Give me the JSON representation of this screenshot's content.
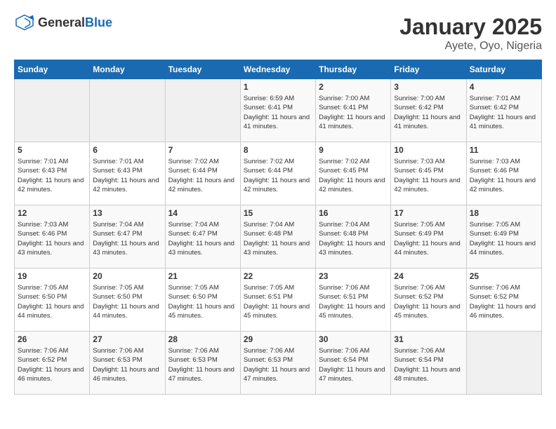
{
  "header": {
    "logo_general": "General",
    "logo_blue": "Blue",
    "title": "January 2025",
    "location": "Ayete, Oyo, Nigeria"
  },
  "weekdays": [
    "Sunday",
    "Monday",
    "Tuesday",
    "Wednesday",
    "Thursday",
    "Friday",
    "Saturday"
  ],
  "weeks": [
    [
      {
        "day": "",
        "empty": true
      },
      {
        "day": "",
        "empty": true
      },
      {
        "day": "",
        "empty": true
      },
      {
        "day": "1",
        "sunrise": "Sunrise: 6:59 AM",
        "sunset": "Sunset: 6:41 PM",
        "daylight": "Daylight: 11 hours and 41 minutes."
      },
      {
        "day": "2",
        "sunrise": "Sunrise: 7:00 AM",
        "sunset": "Sunset: 6:41 PM",
        "daylight": "Daylight: 11 hours and 41 minutes."
      },
      {
        "day": "3",
        "sunrise": "Sunrise: 7:00 AM",
        "sunset": "Sunset: 6:42 PM",
        "daylight": "Daylight: 11 hours and 41 minutes."
      },
      {
        "day": "4",
        "sunrise": "Sunrise: 7:01 AM",
        "sunset": "Sunset: 6:42 PM",
        "daylight": "Daylight: 11 hours and 41 minutes."
      }
    ],
    [
      {
        "day": "5",
        "sunrise": "Sunrise: 7:01 AM",
        "sunset": "Sunset: 6:43 PM",
        "daylight": "Daylight: 11 hours and 42 minutes."
      },
      {
        "day": "6",
        "sunrise": "Sunrise: 7:01 AM",
        "sunset": "Sunset: 6:43 PM",
        "daylight": "Daylight: 11 hours and 42 minutes."
      },
      {
        "day": "7",
        "sunrise": "Sunrise: 7:02 AM",
        "sunset": "Sunset: 6:44 PM",
        "daylight": "Daylight: 11 hours and 42 minutes."
      },
      {
        "day": "8",
        "sunrise": "Sunrise: 7:02 AM",
        "sunset": "Sunset: 6:44 PM",
        "daylight": "Daylight: 11 hours and 42 minutes."
      },
      {
        "day": "9",
        "sunrise": "Sunrise: 7:02 AM",
        "sunset": "Sunset: 6:45 PM",
        "daylight": "Daylight: 11 hours and 42 minutes."
      },
      {
        "day": "10",
        "sunrise": "Sunrise: 7:03 AM",
        "sunset": "Sunset: 6:45 PM",
        "daylight": "Daylight: 11 hours and 42 minutes."
      },
      {
        "day": "11",
        "sunrise": "Sunrise: 7:03 AM",
        "sunset": "Sunset: 6:46 PM",
        "daylight": "Daylight: 11 hours and 42 minutes."
      }
    ],
    [
      {
        "day": "12",
        "sunrise": "Sunrise: 7:03 AM",
        "sunset": "Sunset: 6:46 PM",
        "daylight": "Daylight: 11 hours and 43 minutes."
      },
      {
        "day": "13",
        "sunrise": "Sunrise: 7:04 AM",
        "sunset": "Sunset: 6:47 PM",
        "daylight": "Daylight: 11 hours and 43 minutes."
      },
      {
        "day": "14",
        "sunrise": "Sunrise: 7:04 AM",
        "sunset": "Sunset: 6:47 PM",
        "daylight": "Daylight: 11 hours and 43 minutes."
      },
      {
        "day": "15",
        "sunrise": "Sunrise: 7:04 AM",
        "sunset": "Sunset: 6:48 PM",
        "daylight": "Daylight: 11 hours and 43 minutes."
      },
      {
        "day": "16",
        "sunrise": "Sunrise: 7:04 AM",
        "sunset": "Sunset: 6:48 PM",
        "daylight": "Daylight: 11 hours and 43 minutes."
      },
      {
        "day": "17",
        "sunrise": "Sunrise: 7:05 AM",
        "sunset": "Sunset: 6:49 PM",
        "daylight": "Daylight: 11 hours and 44 minutes."
      },
      {
        "day": "18",
        "sunrise": "Sunrise: 7:05 AM",
        "sunset": "Sunset: 6:49 PM",
        "daylight": "Daylight: 11 hours and 44 minutes."
      }
    ],
    [
      {
        "day": "19",
        "sunrise": "Sunrise: 7:05 AM",
        "sunset": "Sunset: 6:50 PM",
        "daylight": "Daylight: 11 hours and 44 minutes."
      },
      {
        "day": "20",
        "sunrise": "Sunrise: 7:05 AM",
        "sunset": "Sunset: 6:50 PM",
        "daylight": "Daylight: 11 hours and 44 minutes."
      },
      {
        "day": "21",
        "sunrise": "Sunrise: 7:05 AM",
        "sunset": "Sunset: 6:50 PM",
        "daylight": "Daylight: 11 hours and 45 minutes."
      },
      {
        "day": "22",
        "sunrise": "Sunrise: 7:05 AM",
        "sunset": "Sunset: 6:51 PM",
        "daylight": "Daylight: 11 hours and 45 minutes."
      },
      {
        "day": "23",
        "sunrise": "Sunrise: 7:06 AM",
        "sunset": "Sunset: 6:51 PM",
        "daylight": "Daylight: 11 hours and 45 minutes."
      },
      {
        "day": "24",
        "sunrise": "Sunrise: 7:06 AM",
        "sunset": "Sunset: 6:52 PM",
        "daylight": "Daylight: 11 hours and 45 minutes."
      },
      {
        "day": "25",
        "sunrise": "Sunrise: 7:06 AM",
        "sunset": "Sunset: 6:52 PM",
        "daylight": "Daylight: 11 hours and 46 minutes."
      }
    ],
    [
      {
        "day": "26",
        "sunrise": "Sunrise: 7:06 AM",
        "sunset": "Sunset: 6:52 PM",
        "daylight": "Daylight: 11 hours and 46 minutes."
      },
      {
        "day": "27",
        "sunrise": "Sunrise: 7:06 AM",
        "sunset": "Sunset: 6:53 PM",
        "daylight": "Daylight: 11 hours and 46 minutes."
      },
      {
        "day": "28",
        "sunrise": "Sunrise: 7:06 AM",
        "sunset": "Sunset: 6:53 PM",
        "daylight": "Daylight: 11 hours and 47 minutes."
      },
      {
        "day": "29",
        "sunrise": "Sunrise: 7:06 AM",
        "sunset": "Sunset: 6:53 PM",
        "daylight": "Daylight: 11 hours and 47 minutes."
      },
      {
        "day": "30",
        "sunrise": "Sunrise: 7:06 AM",
        "sunset": "Sunset: 6:54 PM",
        "daylight": "Daylight: 11 hours and 47 minutes."
      },
      {
        "day": "31",
        "sunrise": "Sunrise: 7:06 AM",
        "sunset": "Sunset: 6:54 PM",
        "daylight": "Daylight: 11 hours and 48 minutes."
      },
      {
        "day": "",
        "empty": true
      }
    ]
  ]
}
